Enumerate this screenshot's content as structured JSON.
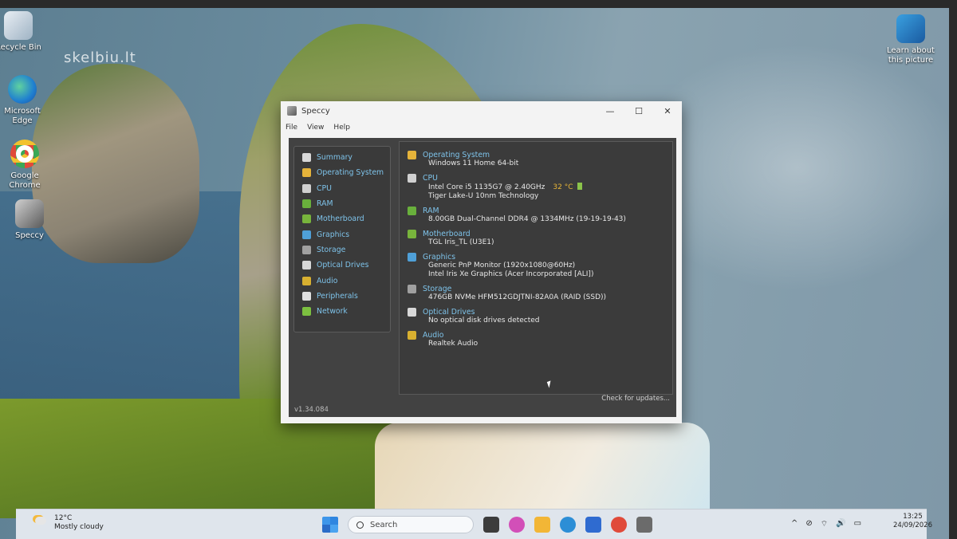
{
  "desktop": {
    "icons": [
      {
        "label": "Recycle Bin",
        "icon": "recycle-bin-icon"
      },
      {
        "label": "Microsoft Edge",
        "icon": "edge-icon"
      },
      {
        "label": "Google Chrome",
        "icon": "chrome-icon"
      },
      {
        "label": "Speccy",
        "icon": "speccy-icon"
      }
    ],
    "learn_about": "Learn about this picture",
    "watermark": "skelbiu.lt"
  },
  "window": {
    "title": "Speccy",
    "controls": {
      "minimize": "—",
      "maximize": "☐",
      "close": "✕"
    },
    "menu": [
      "File",
      "View",
      "Help"
    ],
    "sidebar": [
      {
        "label": "Summary",
        "icon": "summary-icon",
        "color": "#d8d8d8"
      },
      {
        "label": "Operating System",
        "icon": "windows-icon",
        "color": "#e5b33a"
      },
      {
        "label": "CPU",
        "icon": "cpu-icon",
        "color": "#d0d0d0"
      },
      {
        "label": "RAM",
        "icon": "ram-icon",
        "color": "#69b03c"
      },
      {
        "label": "Motherboard",
        "icon": "motherboard-icon",
        "color": "#78b43c"
      },
      {
        "label": "Graphics",
        "icon": "graphics-icon",
        "color": "#4fa0d8"
      },
      {
        "label": "Storage",
        "icon": "storage-icon",
        "color": "#a0a0a0"
      },
      {
        "label": "Optical Drives",
        "icon": "optical-drive-icon",
        "color": "#d8d8d8"
      },
      {
        "label": "Audio",
        "icon": "audio-icon",
        "color": "#d8b030"
      },
      {
        "label": "Peripherals",
        "icon": "peripherals-icon",
        "color": "#e0e0e0"
      },
      {
        "label": "Network",
        "icon": "network-icon",
        "color": "#7cc040"
      }
    ],
    "sections": [
      {
        "title": "Operating System",
        "icon": "windows-icon",
        "color": "#e5b33a",
        "lines": [
          "Windows 11 Home 64-bit"
        ]
      },
      {
        "title": "CPU",
        "icon": "cpu-icon",
        "color": "#d0d0d0",
        "lines": [
          "Intel Core i5 1135G7 @ 2.40GHz",
          "Tiger Lake-U 10nm Technology"
        ],
        "temp": "32 °C"
      },
      {
        "title": "RAM",
        "icon": "ram-icon",
        "color": "#69b03c",
        "lines": [
          "8.00GB Dual-Channel DDR4 @ 1334MHz (19-19-19-43)"
        ]
      },
      {
        "title": "Motherboard",
        "icon": "motherboard-icon",
        "color": "#78b43c",
        "lines": [
          "TGL Iris_TL (U3E1)"
        ]
      },
      {
        "title": "Graphics",
        "icon": "graphics-icon",
        "color": "#4fa0d8",
        "lines": [
          "Generic PnP Monitor (1920x1080@60Hz)",
          "Intel Iris Xe Graphics (Acer Incorporated [ALI])"
        ]
      },
      {
        "title": "Storage",
        "icon": "storage-icon",
        "color": "#a0a0a0",
        "lines": [
          "476GB NVMe HFM512GDJTNI-82A0A (RAID (SSD))"
        ]
      },
      {
        "title": "Optical Drives",
        "icon": "optical-drive-icon",
        "color": "#d8d8d8",
        "lines": [
          "No optical disk drives detected"
        ]
      },
      {
        "title": "Audio",
        "icon": "audio-icon",
        "color": "#d8b030",
        "lines": [
          "Realtek Audio"
        ]
      }
    ],
    "version": "v1.34.084",
    "check_updates": "Check for updates..."
  },
  "taskbar": {
    "weather_temp": "12°C",
    "weather_desc": "Mostly cloudy",
    "search_placeholder": "Search",
    "apps": [
      {
        "icon": "task-view-icon",
        "color": "#3c3c3c"
      },
      {
        "icon": "copilot-icon",
        "color": "#d24fb8"
      },
      {
        "icon": "file-explorer-icon",
        "color": "#f2b636"
      },
      {
        "icon": "edge-icon",
        "color": "#2c8ed6"
      },
      {
        "icon": "store-icon",
        "color": "#2f6bd0"
      },
      {
        "icon": "chrome-icon",
        "color": "#e04a3a"
      },
      {
        "icon": "speccy-icon",
        "color": "#6b6b6b"
      }
    ],
    "tray": [
      "^",
      "⊘",
      "⌔",
      "🔊",
      "▭"
    ],
    "time": "13:25",
    "date": "24/09/2026"
  }
}
